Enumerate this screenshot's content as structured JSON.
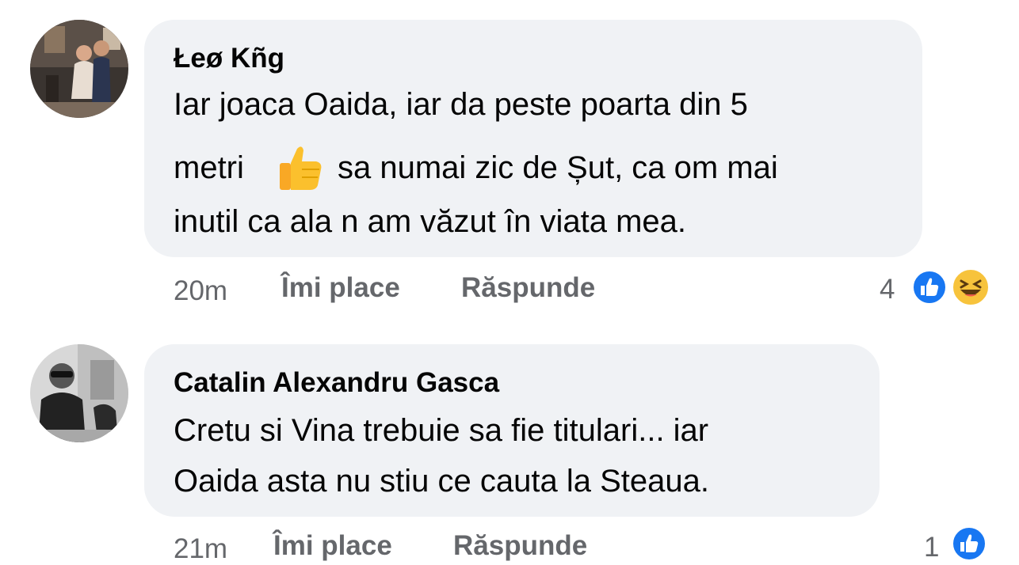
{
  "comments": [
    {
      "author": "Łeø Kñg",
      "lines": [
        "Iar joaca Oaida, iar da peste poarta din 5",
        "metri",
        "sa numai zic de Șut, ca om mai",
        "inutil ca ala n am văzut în viata mea."
      ],
      "emoji": "thumbs-up-emoji",
      "time": "20m",
      "like_label": "Îmi place",
      "reply_label": "Răspunde",
      "reaction_count": "4",
      "reactions": [
        "like-icon",
        "haha-icon"
      ]
    },
    {
      "author": "Catalin Alexandru Gasca",
      "lines": [
        "Cretu si Vina trebuie sa fie titulari... iar",
        "Oaida asta nu stiu ce cauta la Steaua."
      ],
      "time": "21m",
      "like_label": "Îmi place",
      "reply_label": "Răspunde",
      "reaction_count": "1",
      "reactions": [
        "like-icon"
      ]
    }
  ],
  "colors": {
    "bubble": "#f0f2f5",
    "text": "#050505",
    "meta": "#65676b",
    "like_blue": "#1877f2",
    "haha_yellow": "#f7c33c"
  }
}
